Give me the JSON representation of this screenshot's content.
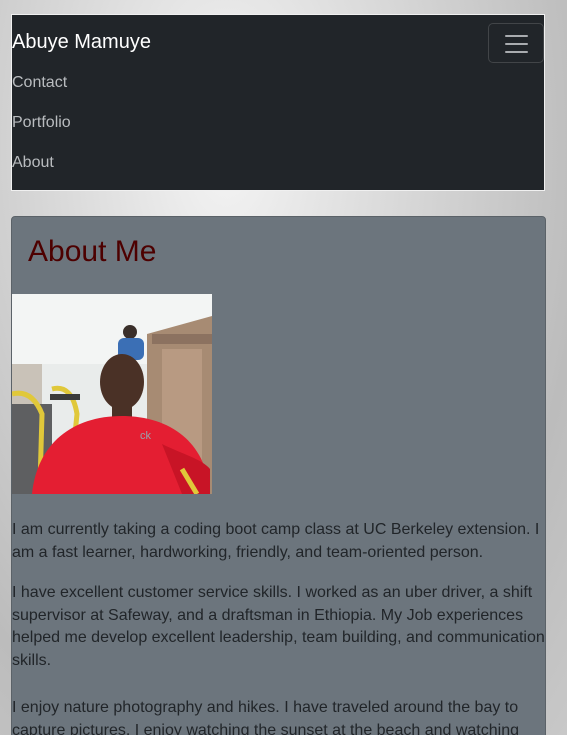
{
  "navbar": {
    "brand": "Abuye Mamuye",
    "links": [
      "Contact",
      "Portfolio",
      "About"
    ]
  },
  "about": {
    "heading": "About Me",
    "paragraphs": [
      "I am currently taking a coding boot camp class at UC Berkeley extension. I am a fast learner, hardworking, friendly, and team-oriented person.",
      "I have excellent customer service skills. I worked as an uber driver, a shift supervisor at Safeway, and a draftsman in Ethiopia. My Job experiences helped me develop excellent leadership, team building, and communication skills.",
      "I enjoy nature photography and hikes. I have traveled around the bay to capture pictures. I enjoy watching the sunset at the beach and watching"
    ]
  },
  "colors": {
    "navbar_bg": "#212529",
    "card_bg": "#6c757d",
    "heading": "#4d0000"
  },
  "icons": {
    "toggler": "hamburger-icon"
  }
}
